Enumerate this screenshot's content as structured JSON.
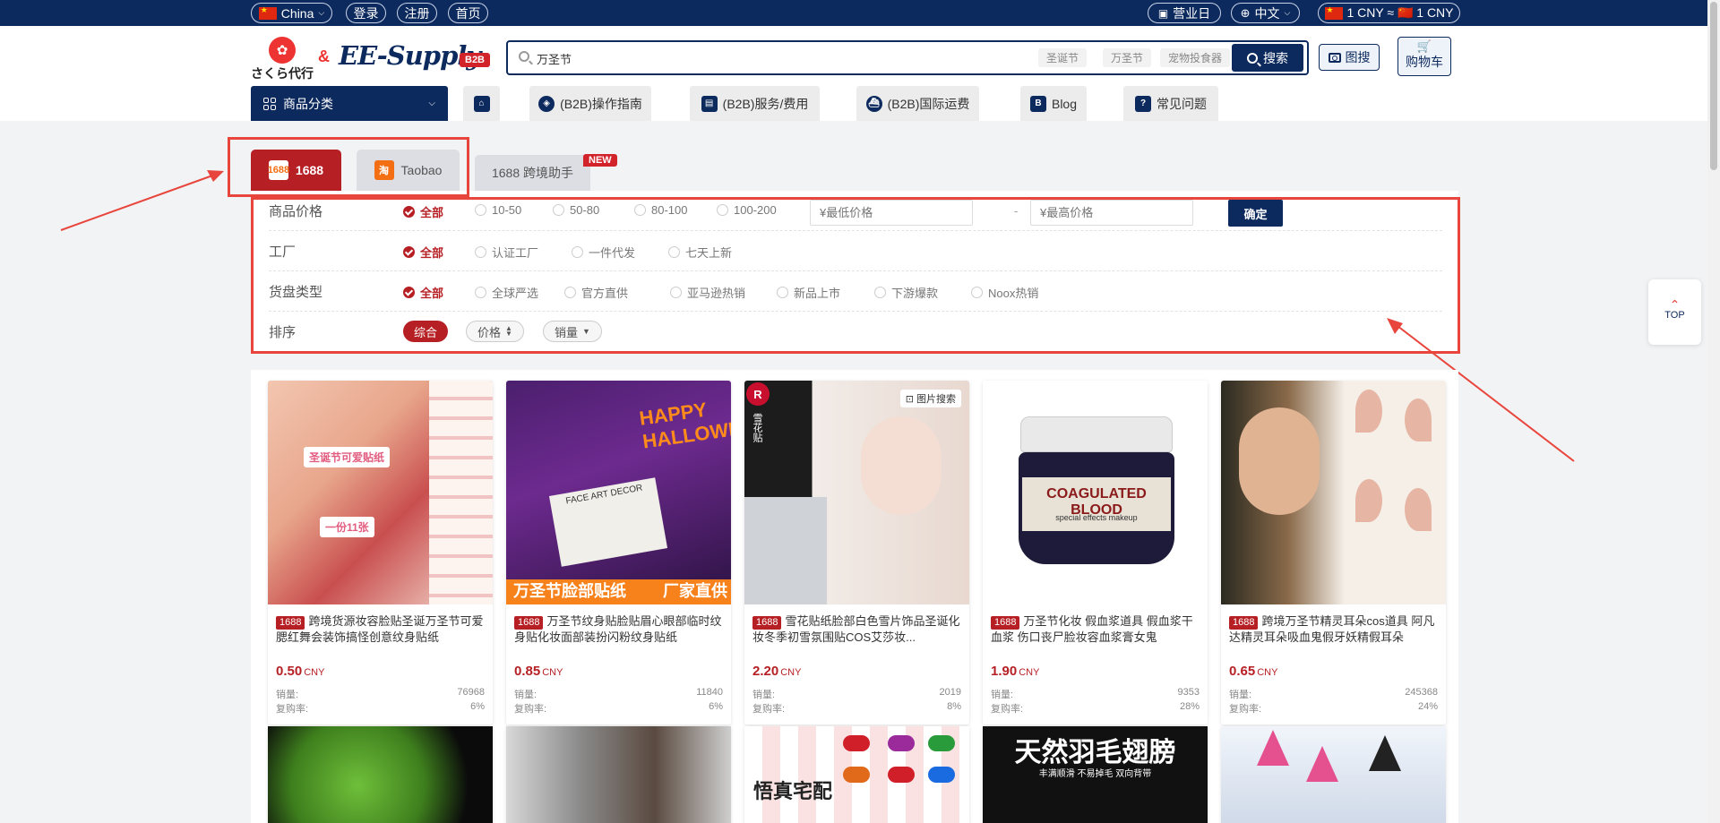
{
  "topbar": {
    "region": "China",
    "login": "登录",
    "register": "注册",
    "home": "首页",
    "business_day": "营业日",
    "language": "中文",
    "exchange": "1 CNY ≈ 🇨🇳 1 CNY"
  },
  "brand": {
    "sakura_text": "さくら代行",
    "amp": "&",
    "ee_supply": "EE-Supply",
    "b2b": "B2B"
  },
  "search": {
    "value": "万圣节",
    "suggestions": [
      "圣诞节",
      "万圣节",
      "宠物投食器"
    ],
    "button": "搜索",
    "image_search": "图搜",
    "cart": "购物车"
  },
  "nav": {
    "category": "商品分类",
    "items": [
      "(B2B)操作指南",
      "(B2B)服务/费用",
      "(B2B)国际运费",
      "Blog",
      "常见问题"
    ]
  },
  "platforms": {
    "tab1": "1688",
    "tab2": "Taobao",
    "tab3": "1688 跨境助手",
    "new_badge": "NEW"
  },
  "filters": {
    "price": {
      "label": "商品价格",
      "options": [
        "全部",
        "10-50",
        "50-80",
        "80-100",
        "100-200"
      ],
      "min_placeholder": "¥最低价格",
      "max_placeholder": "¥最高价格",
      "dash": "-",
      "confirm": "确定"
    },
    "factory": {
      "label": "工厂",
      "options": [
        "全部",
        "认证工厂",
        "一件代发",
        "七天上新"
      ]
    },
    "supply": {
      "label": "货盘类型",
      "options": [
        "全部",
        "全球严选",
        "官方直供",
        "亚马逊热销",
        "新品上市",
        "下游爆款",
        "Noox热销"
      ]
    },
    "sort": {
      "label": "排序",
      "options": [
        "综合",
        "价格",
        "销量"
      ]
    }
  },
  "products": [
    {
      "tag": "1688",
      "title": "跨境货源妆容脸贴圣诞万圣节可爱腮红舞会装饰搞怪创意纹身贴纸",
      "price": "0.50",
      "currency": "CNY",
      "sales_label": "销量:",
      "sales": "76968",
      "repurchase_label": "复购率:",
      "repurchase": "6%",
      "overlay1": "圣诞节可爱贴纸",
      "overlay2": "一份11张"
    },
    {
      "tag": "1688",
      "title": "万圣节纹身贴脸贴眉心眼部临时纹身贴化妆面部装扮闪粉纹身贴纸",
      "price": "0.85",
      "currency": "CNY",
      "sales_label": "销量:",
      "sales": "11840",
      "repurchase_label": "复购率:",
      "repurchase": "6%",
      "overlay1": "万圣节脸部贴纸",
      "overlay2": "厂家直供",
      "overlay3": "HAPPY HALLOWEEN",
      "overlay4": "FACE ART DECOR"
    },
    {
      "tag": "1688",
      "title": "雪花贴纸脸部白色雪片饰品圣诞化妆冬季初雪氛围贴COS艾莎妆...",
      "price": "2.20",
      "currency": "CNY",
      "sales_label": "销量:",
      "sales": "2019",
      "repurchase_label": "复购率:",
      "repurchase": "8%",
      "overlay1": "图片搜索",
      "overlay2": "R",
      "overlay3": "雪花贴"
    },
    {
      "tag": "1688",
      "title": "万圣节化妆 假血浆道具 假血浆干血浆 伤口丧尸脸妆容血浆膏女鬼",
      "price": "1.90",
      "currency": "CNY",
      "sales_label": "销量:",
      "sales": "9353",
      "repurchase_label": "复购率:",
      "repurchase": "28%",
      "overlay1": "COAGULATED BLOOD",
      "overlay2": "special effects makeup"
    },
    {
      "tag": "1688",
      "title": "跨境万圣节精灵耳朵cos道具 阿凡达精灵耳朵吸血鬼假牙妖精假耳朵",
      "price": "0.65",
      "currency": "CNY",
      "sales_label": "销量:",
      "sales": "245368",
      "repurchase_label": "复购率:",
      "repurchase": "24%"
    }
  ],
  "products_row2": [
    {
      "caption": ""
    },
    {
      "caption": ""
    },
    {
      "caption": "悟真宅配"
    },
    {
      "caption": "天然羽毛翅膀",
      "sub": "丰满顺滑   不易掉毛   双向背带"
    },
    {
      "caption": ""
    }
  ],
  "top_button": "TOP",
  "colors": {
    "navy": "#0d2a5e",
    "red": "#b61f24",
    "annotation": "#e8453c"
  }
}
